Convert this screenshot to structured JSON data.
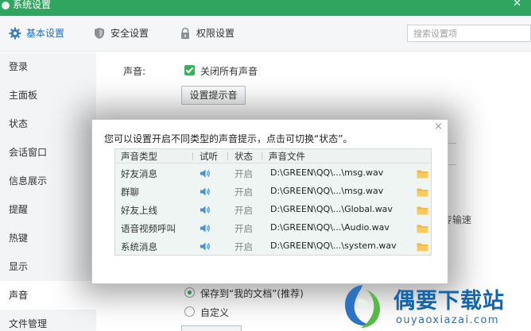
{
  "window": {
    "title": "系统设置",
    "close_glyph": "✕"
  },
  "tabs": [
    {
      "label": "基本设置",
      "icon": "gear-icon",
      "active": true
    },
    {
      "label": "安全设置",
      "icon": "shield-icon"
    },
    {
      "label": "权限设置",
      "icon": "lock-icon"
    }
  ],
  "search": {
    "placeholder": "搜索设置项"
  },
  "sidebar": {
    "items": [
      {
        "label": "登录"
      },
      {
        "label": "主面板"
      },
      {
        "label": "状态"
      },
      {
        "label": "会话窗口"
      },
      {
        "label": "信息展示"
      },
      {
        "label": "提醒"
      },
      {
        "label": "热键"
      },
      {
        "label": "显示"
      },
      {
        "label": "声音",
        "active": true
      },
      {
        "label": "文件管理"
      }
    ]
  },
  "sound": {
    "label": "声音:",
    "mute_all": {
      "label": "关闭所有声音",
      "checked": true
    },
    "tone_button": "设置提示音",
    "partial_text": "专输速",
    "save_options": [
      {
        "label": "保存到“我的文档”(推荐)",
        "selected": true
      },
      {
        "label": "自定义",
        "selected": false
      }
    ]
  },
  "popup": {
    "close_glyph": "×",
    "message": "您可以设置开启不同类型的声音提示，点击可切换“状态”。",
    "columns": {
      "type": "声音类型",
      "listen": "试听",
      "state": "状态",
      "file": "声音文件"
    },
    "rows": [
      {
        "type": "好友消息",
        "state": "开启",
        "file": "D:\\GREEN\\QQ\\...\\msg.wav"
      },
      {
        "type": "群聊",
        "state": "开启",
        "file": "D:\\GREEN\\QQ\\...\\msg.wav"
      },
      {
        "type": "好友上线",
        "state": "开启",
        "file": "D:\\GREEN\\QQ\\...\\Global.wav"
      },
      {
        "type": "语音视频呼叫",
        "state": "开启",
        "file": "D:\\GREEN\\QQ\\...\\Audio.wav"
      },
      {
        "type": "系统消息",
        "state": "开启",
        "file": "D:\\GREEN\\QQ\\...\\system.wav"
      }
    ]
  },
  "watermark": {
    "name": "偶要下载站",
    "url": "ouyaoxiazai.com"
  },
  "colors": {
    "titlebar": "#2fa55f",
    "accent_blue": "#1f6fb8",
    "check_green": "#3fae63",
    "folder": "#f4b63f"
  }
}
